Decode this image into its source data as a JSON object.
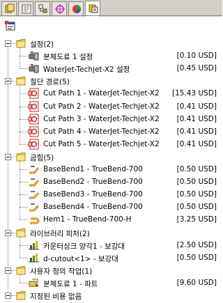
{
  "tabs": [
    {
      "icon": "feature-manager-icon",
      "active": false
    },
    {
      "icon": "property-manager-icon",
      "active": false
    },
    {
      "icon": "configuration-manager-icon",
      "active": false
    },
    {
      "icon": "dimxpert-icon",
      "active": false
    },
    {
      "icon": "display-manager-icon",
      "active": false
    },
    {
      "icon": "cost-manager-icon",
      "active": true
    }
  ],
  "toolbar": {
    "icon": "cost-template-icon"
  },
  "groups": [
    {
      "label": "설정(2)",
      "items": [
        {
          "icon": "setup-icon",
          "label": "분체도료 1 설정",
          "price": "[0.10 USD]"
        },
        {
          "icon": "setup-icon",
          "label": "WaterJet-Techjet-X2 설정",
          "price": "[0.45 USD]"
        }
      ]
    },
    {
      "label": "절단 경로(5)",
      "items": [
        {
          "icon": "cut-path-icon",
          "label": "Cut Path 1 - WaterJet-Techjet-X2",
          "price": "[15.43 USD]"
        },
        {
          "icon": "cut-path-icon",
          "label": "Cut Path 2 - WaterJet-Techjet-X2",
          "price": "[0.41 USD]"
        },
        {
          "icon": "cut-path-icon",
          "label": "Cut Path 3 - WaterJet-Techjet-X2",
          "price": "[0.41 USD]"
        },
        {
          "icon": "cut-path-icon",
          "label": "Cut Path 4 - WaterJet-Techjet-X2",
          "price": "[0.41 USD]"
        },
        {
          "icon": "cut-path-icon",
          "label": "Cut Path 5 - WaterJet-Techjet-X2",
          "price": "[0.41 USD]"
        }
      ]
    },
    {
      "label": "굽힘(5)",
      "items": [
        {
          "icon": "bend-icon",
          "label": "BaseBend1 - TrueBend-700",
          "price": "[0.50 USD]"
        },
        {
          "icon": "bend-icon",
          "label": "BaseBend2 - TrueBend-700",
          "price": "[0.50 USD]"
        },
        {
          "icon": "bend-icon",
          "label": "BaseBend3 - TrueBend-700",
          "price": "[0.50 USD]"
        },
        {
          "icon": "bend-icon",
          "label": "BaseBend4 - TrueBend-700",
          "price": "[0.50 USD]"
        },
        {
          "icon": "hem-icon",
          "label": "Hem1 - TrueBend-700-H",
          "price": "[3.25 USD]"
        }
      ]
    },
    {
      "label": "라이브러리 피처(2)",
      "items": [
        {
          "icon": "library-feature-icon",
          "label": "카운터싱크 양각1 - 보강대",
          "price": "[2.50 USD]"
        },
        {
          "icon": "library-feature-icon",
          "label": "d-cutout<1> - 보강대",
          "price": "[0.50 USD]"
        }
      ]
    },
    {
      "label": "사용자 정의 작업(1)",
      "items": [
        {
          "icon": "custom-operation-icon",
          "label": "분체도료 1 - 파트",
          "price": "[9.60 USD]"
        }
      ]
    },
    {
      "label": "지정된 비용 없음",
      "items": []
    }
  ]
}
